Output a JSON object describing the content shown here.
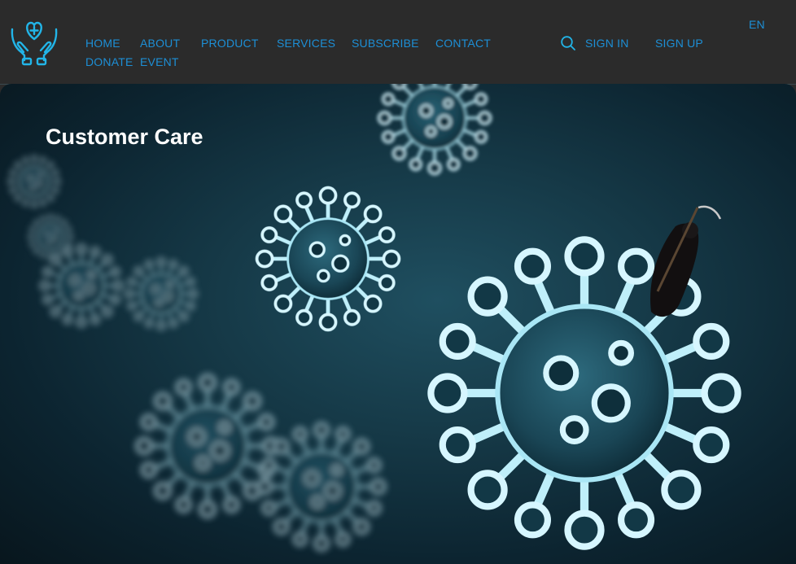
{
  "nav": {
    "row1": [
      "HOME",
      "ABOUT",
      "PRODUCT",
      "SERVICES",
      "SUBSCRIBE",
      "CONTACT"
    ],
    "row2": [
      "DONATE",
      "EVENT"
    ],
    "sign_in": "SIGN IN",
    "sign_up": "SIGN UP",
    "language": "EN"
  },
  "hero": {
    "title": "Customer Care"
  },
  "colors": {
    "accent": "#1d8fd6",
    "logo": "#22b5e8",
    "header_bg": "#2b2b2b"
  },
  "icons": {
    "logo": "heart-hands-icon",
    "search": "search-icon"
  }
}
